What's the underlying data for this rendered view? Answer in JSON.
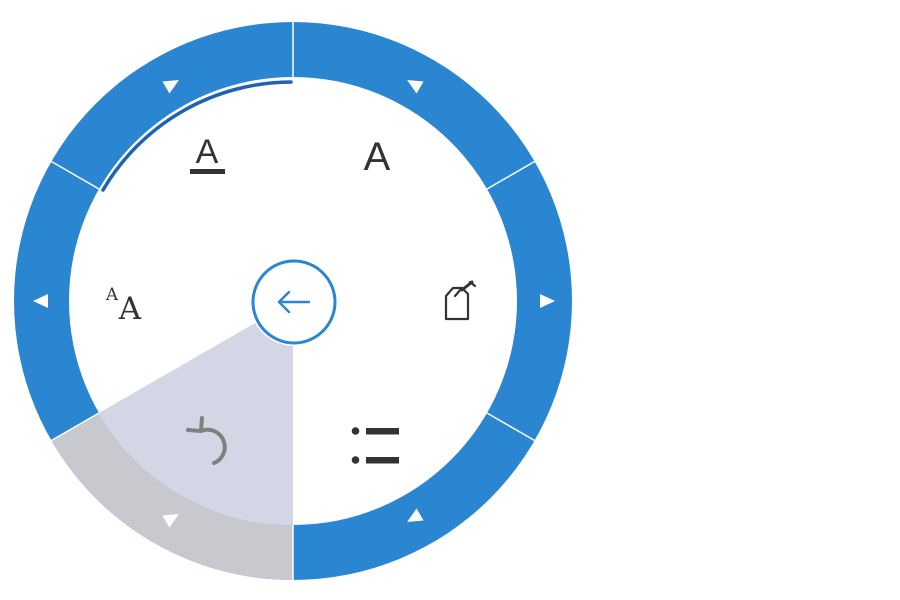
{
  "colors": {
    "ring": "#2b86d2",
    "ring_selected": "#c7c9cf",
    "sector_selected": "#d3d6e4",
    "center_accent": "#2b86d2",
    "highlight_arc": "#1f62b0",
    "icon": "#333333",
    "undo_icon": "#808080",
    "background": "#ffffff"
  },
  "menu": {
    "items": [
      {
        "id": "font-color",
        "icon": "underline-a-icon",
        "glyph": "A",
        "selected": false
      },
      {
        "id": "font",
        "icon": "font-a-icon",
        "glyph": "A",
        "selected": false
      },
      {
        "id": "highlighter",
        "icon": "highlighter-pen-icon",
        "glyph": "",
        "selected": false
      },
      {
        "id": "bullets",
        "icon": "bullet-list-icon",
        "glyph": "",
        "selected": false
      },
      {
        "id": "undo",
        "icon": "undo-icon",
        "glyph": "",
        "selected": true
      },
      {
        "id": "font-size",
        "icon": "font-size-icon",
        "glyph_small": "A",
        "glyph_large": "A",
        "selected": false
      }
    ],
    "center": {
      "icon": "back-arrow-icon"
    },
    "active_item": "font-color"
  }
}
